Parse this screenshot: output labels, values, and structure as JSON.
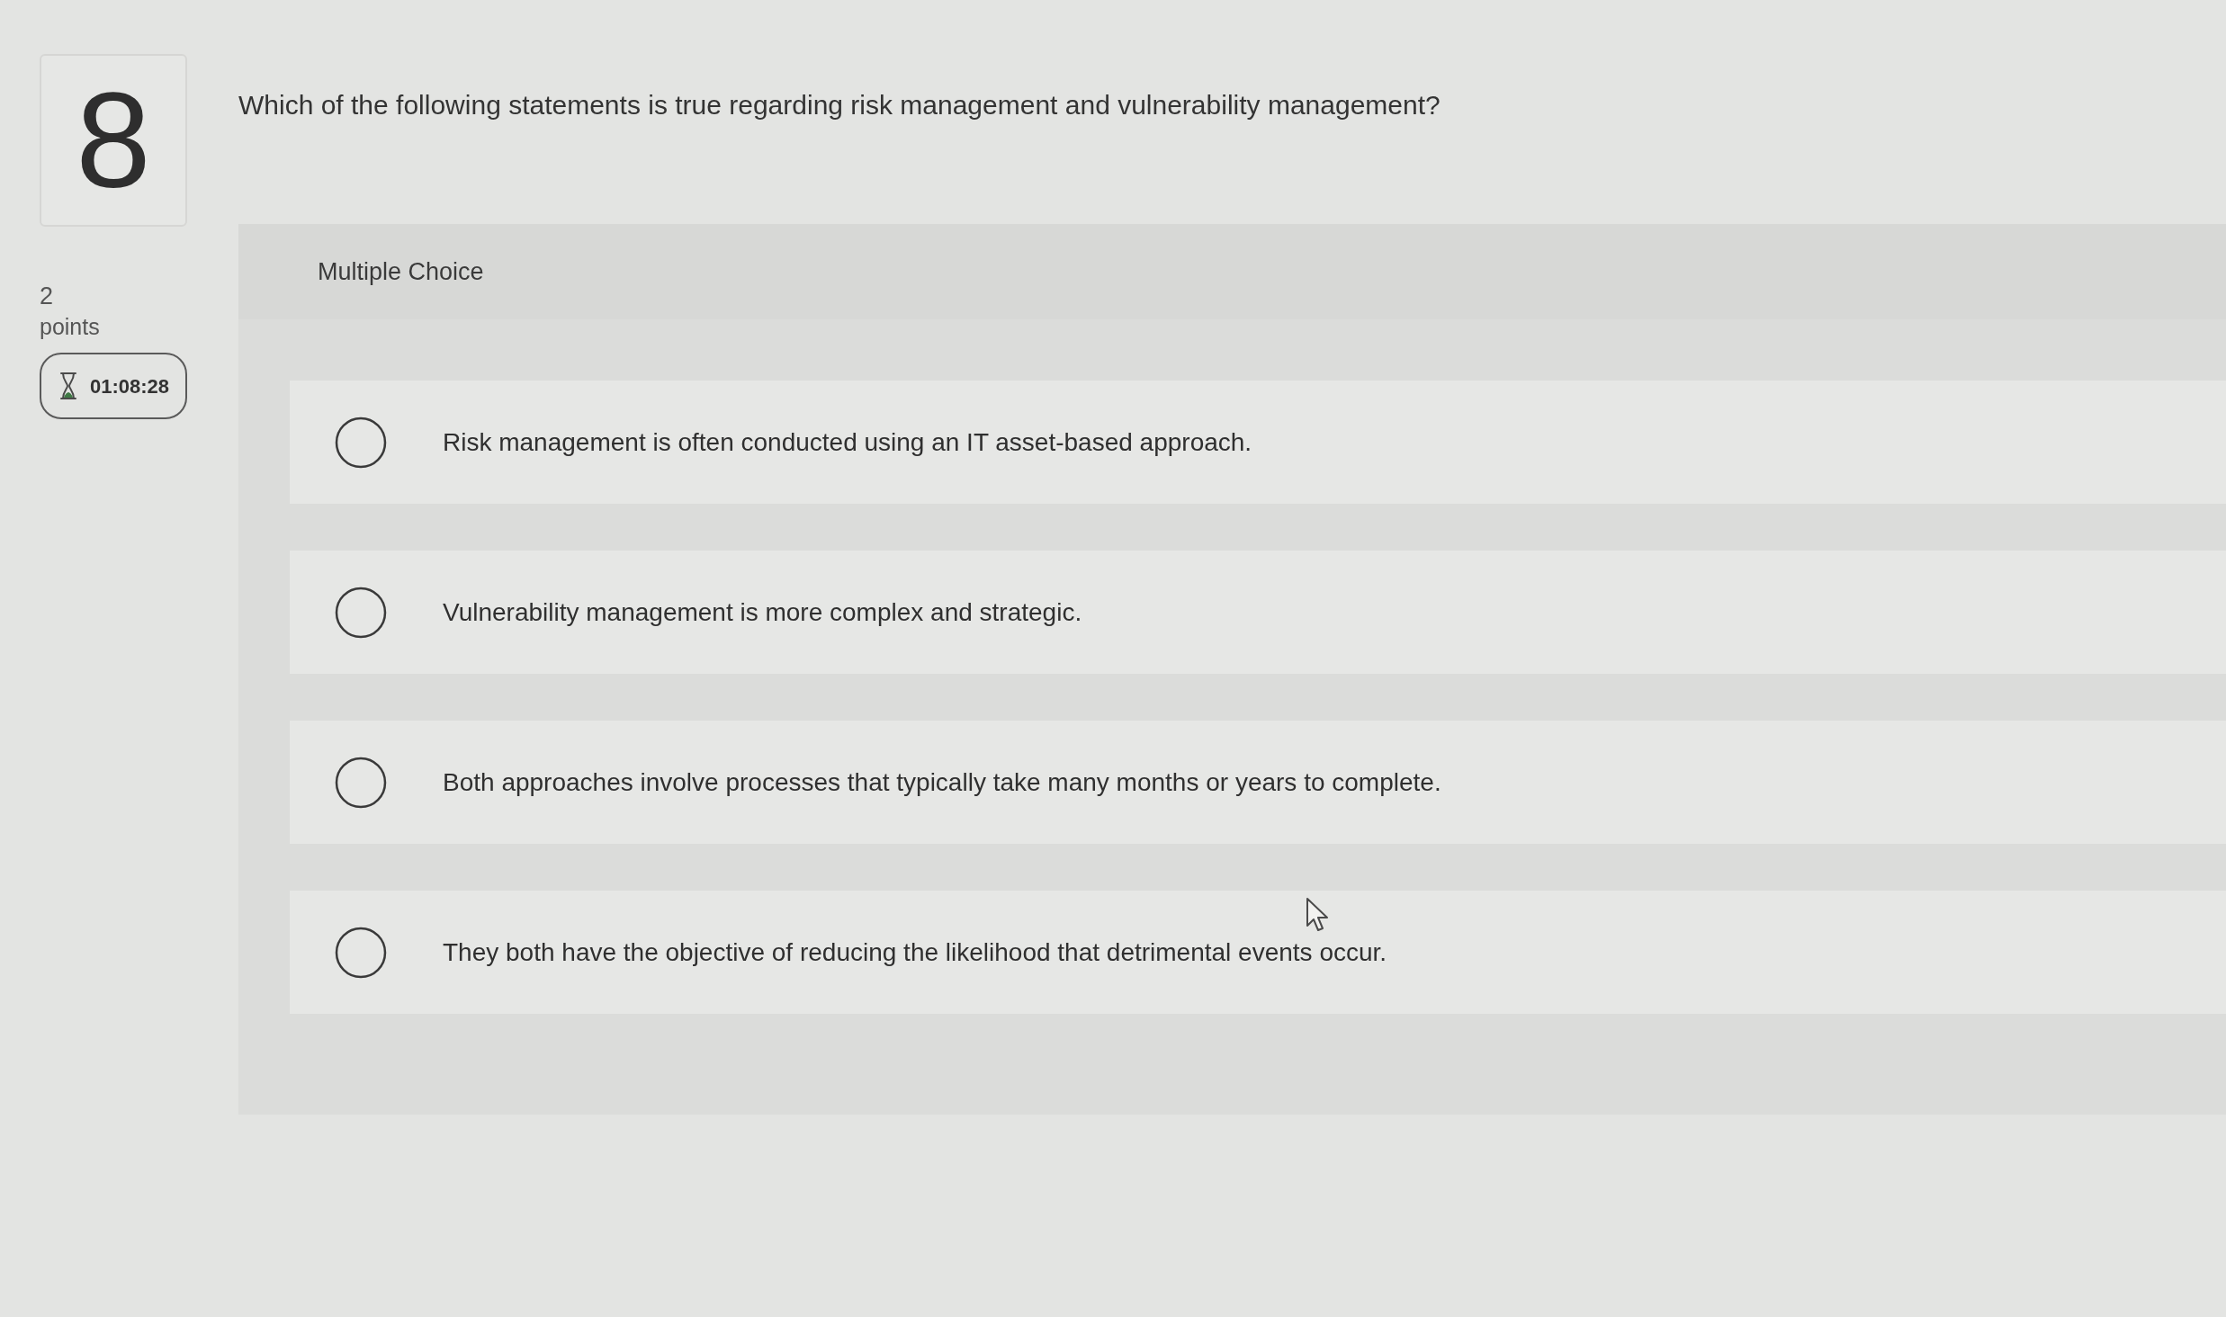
{
  "question": {
    "number": "8",
    "points_value": "2",
    "points_label": "points",
    "timer": "01:08:28",
    "text": "Which of the following statements is true regarding risk management and vulnerability management?"
  },
  "answer_panel": {
    "type_label": "Multiple Choice",
    "options": [
      {
        "text": "Risk management is often conducted using an IT asset-based approach.",
        "selected": false
      },
      {
        "text": "Vulnerability management is more complex and strategic.",
        "selected": false
      },
      {
        "text": "Both approaches involve processes that typically take many months or years to complete.",
        "selected": false
      },
      {
        "text": "They both have the objective of reducing the likelihood that detrimental events occur.",
        "selected": false
      }
    ]
  }
}
